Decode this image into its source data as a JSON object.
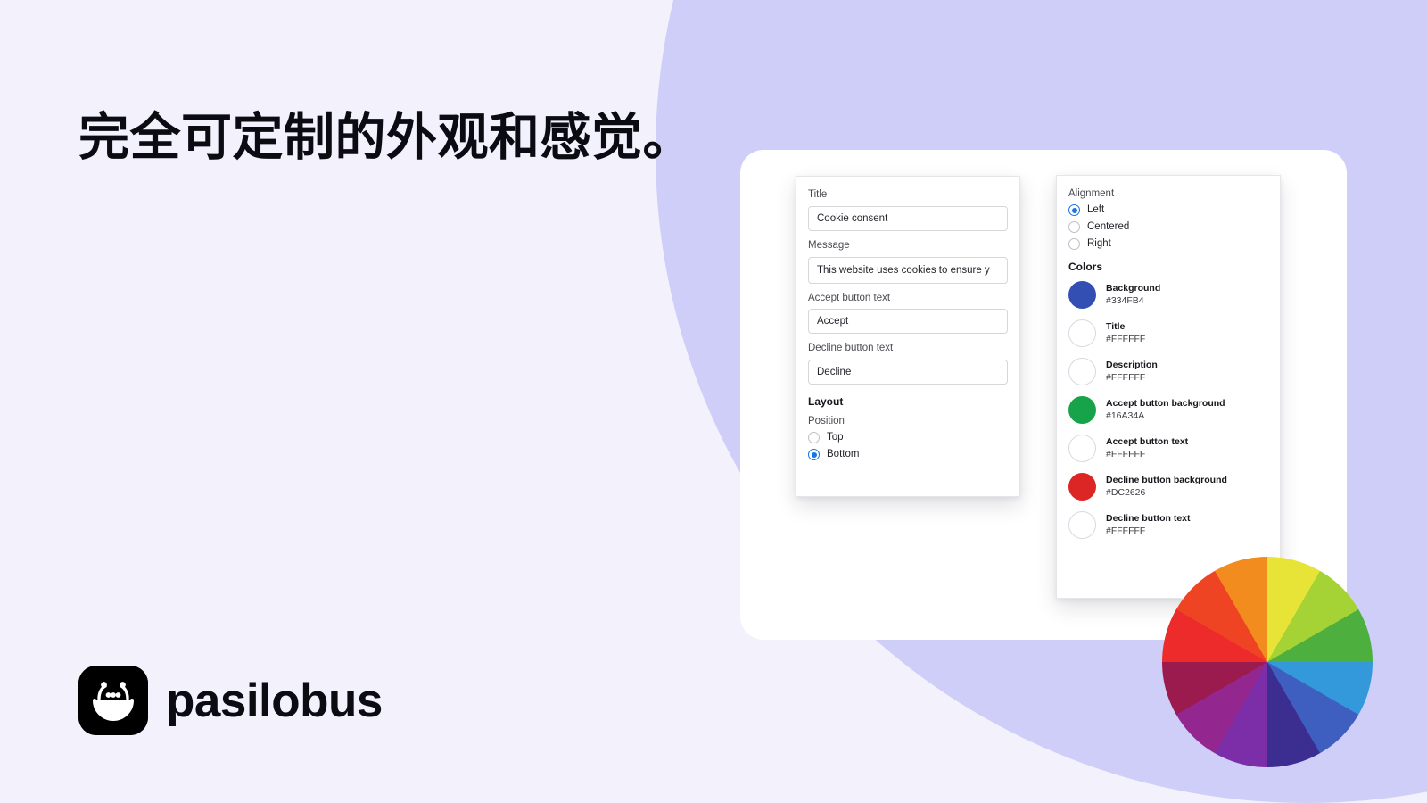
{
  "headline": "完全可定制的外观和感觉。",
  "brand": {
    "name": "pasilobus",
    "mark_icon": "smiley-face-icon"
  },
  "theme": {
    "page_background": "#F2F1FC",
    "blob_color": "#CFCEF8",
    "card_background": "#FFFFFF",
    "accent_radio": "#1A73E8",
    "headline_color": "#0B0B12"
  },
  "settings_panel": {
    "fields": [
      {
        "label": "Title",
        "value": "Cookie consent"
      },
      {
        "label": "Message",
        "value": "This website uses cookies to ensure y"
      },
      {
        "label": "Accept button text",
        "value": "Accept"
      },
      {
        "label": "Decline button text",
        "value": "Decline"
      }
    ],
    "layout_heading": "Layout",
    "position_label": "Position",
    "position_options": [
      {
        "label": "Top",
        "checked": false
      },
      {
        "label": "Bottom",
        "checked": true
      }
    ]
  },
  "appearance_panel": {
    "alignment_label": "Alignment",
    "alignment_options": [
      {
        "label": "Left",
        "checked": true
      },
      {
        "label": "Centered",
        "checked": false
      },
      {
        "label": "Right",
        "checked": false
      }
    ],
    "colors_heading": "Colors",
    "colors": [
      {
        "name": "Background",
        "hex": "#334FB4",
        "light": false
      },
      {
        "name": "Title",
        "hex": "#FFFFFF",
        "light": true
      },
      {
        "name": "Description",
        "hex": "#FFFFFF",
        "light": true
      },
      {
        "name": "Accept button background",
        "hex": "#16A34A",
        "light": false
      },
      {
        "name": "Accept button text",
        "hex": "#FFFFFF",
        "light": true
      },
      {
        "name": "Decline button background",
        "hex": "#DC2626",
        "light": false
      },
      {
        "name": "Decline button text",
        "hex": "#FFFFFF",
        "light": true
      }
    ]
  },
  "color_wheel": {
    "icon": "color-wheel-icon",
    "segment_count": 12,
    "segments": [
      "#E8E337",
      "#A5D234",
      "#4CAF3E",
      "#3399DB",
      "#3F5FC0",
      "#3C2E91",
      "#7B2EA8",
      "#93278F",
      "#9B1B4E",
      "#ED2B2B",
      "#EF4423",
      "#F28C1E"
    ],
    "extra_segments": [
      "#EFA817",
      "#E8B517"
    ]
  }
}
